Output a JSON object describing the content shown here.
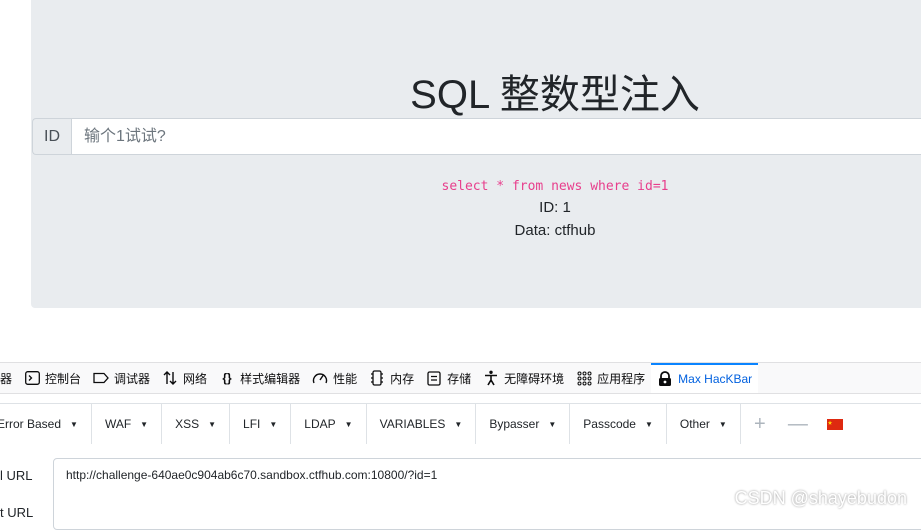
{
  "page": {
    "title": "SQL 整数型注入",
    "input_prefix": "ID",
    "input_placeholder": "输个1试试?",
    "input_value": "",
    "sql_query": "select * from news where id=1",
    "result_id": "ID: 1",
    "result_data": "Data: ctfhub"
  },
  "devtools": {
    "tabs": [
      {
        "label": "器",
        "icon": "inspector-icon"
      },
      {
        "label": "控制台",
        "icon": "console-icon"
      },
      {
        "label": "调试器",
        "icon": "debugger-icon"
      },
      {
        "label": "网络",
        "icon": "network-icon"
      },
      {
        "label": "样式编辑器",
        "icon": "style-editor-icon"
      },
      {
        "label": "性能",
        "icon": "performance-icon"
      },
      {
        "label": "内存",
        "icon": "memory-icon"
      },
      {
        "label": "存储",
        "icon": "storage-icon"
      },
      {
        "label": "无障碍环境",
        "icon": "accessibility-icon"
      },
      {
        "label": "应用程序",
        "icon": "application-icon"
      },
      {
        "label": "Max HacKBar",
        "icon": "hackbar-icon",
        "active": true
      }
    ]
  },
  "hackbar": {
    "menus": [
      "Error Based",
      "WAF",
      "XSS",
      "LFI",
      "LDAP",
      "VARIABLES",
      "Bypasser",
      "Passcode",
      "Other"
    ],
    "load_url_label": "l URL",
    "split_url_label": "t URL",
    "url_value": "http://challenge-640ae0c904ab6c70.sandbox.ctfhub.com:10800/?id=1"
  },
  "watermark": "CSDN @shayebudon",
  "colors": {
    "jumbotron_bg": "#e9ecef",
    "sql_pink": "#e83e8c",
    "active_tab_blue": "#0a84ff"
  }
}
